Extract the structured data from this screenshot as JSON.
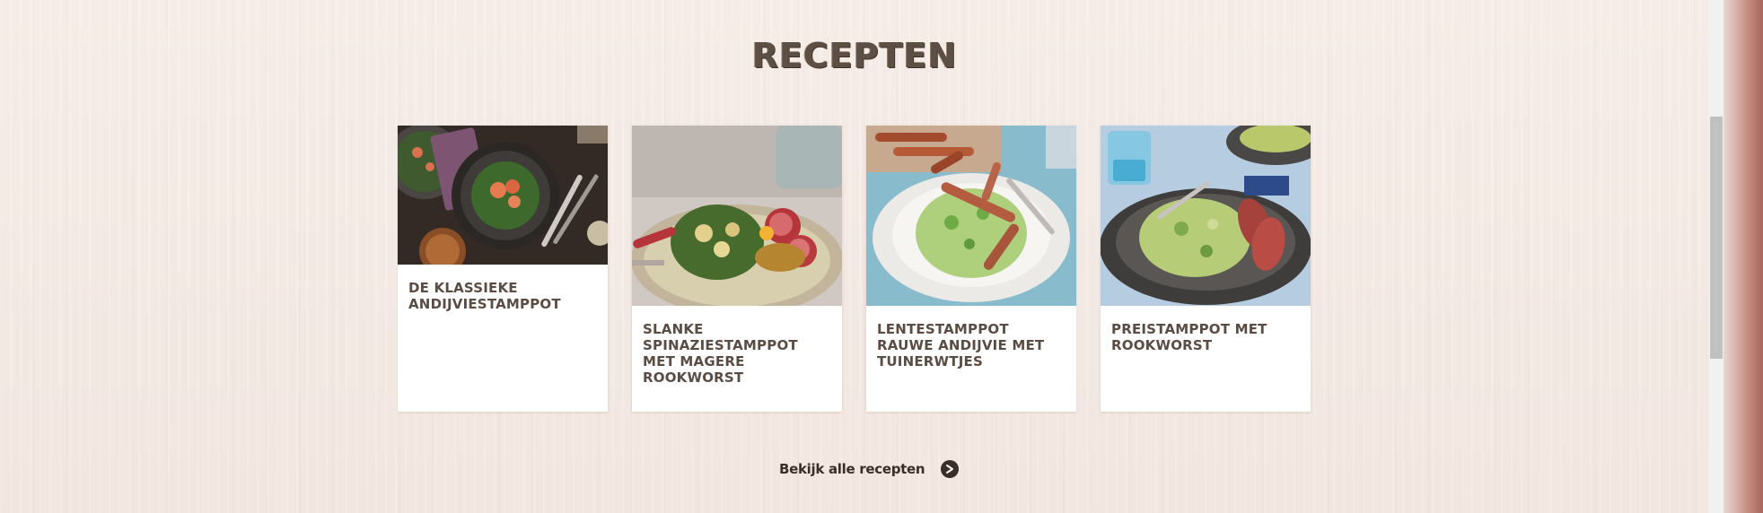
{
  "section": {
    "title": "RECEPTEN"
  },
  "recipes": [
    {
      "title": "DE KLASSIEKE ANDIJVIESTAMPPOT",
      "image_icon": "recipe-photo-icon"
    },
    {
      "title": "SLANKE SPINAZIESTAMPPOT MET MAGERE ROOKWORST",
      "image_icon": "recipe-photo-icon"
    },
    {
      "title": "LENTESTAMPPOT RAUWE ANDIJVIE MET TUINERWTJES",
      "image_icon": "recipe-photo-icon"
    },
    {
      "title": "PREISTAMPPOT MET ROOKWORST",
      "image_icon": "recipe-photo-icon"
    }
  ],
  "more": {
    "label": "Bekijk alle recepten",
    "icon": "arrow-right-circle-icon"
  },
  "colors": {
    "background": "#f3e9e4",
    "title_text": "#5d4f44",
    "card_text": "#5a4c42",
    "link_text": "#3a2e27",
    "arrow_circle": "#3a2e27"
  }
}
